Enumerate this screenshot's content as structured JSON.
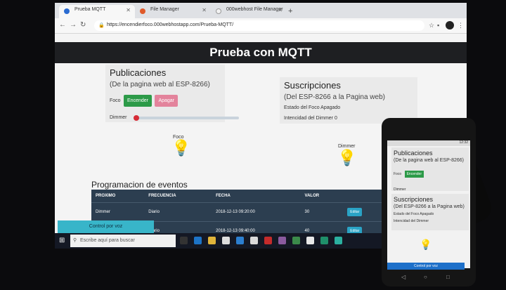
{
  "browser": {
    "tabs": [
      {
        "label": "Prueba MQTT"
      },
      {
        "label": "File Manager"
      },
      {
        "label": "000webhost File Manager"
      }
    ],
    "url": "https://encendierfoco.000webhostapp.com/Prueba-MQTT/"
  },
  "page": {
    "title": "Prueba con MQTT",
    "publicaciones": {
      "title": "Publicaciones",
      "subtitle": "(De la pagina web al ESP-8266)",
      "foco_label": "Foco",
      "on_label": "Encender",
      "off_label": "Apagar",
      "dimmer_label": "Dimmer"
    },
    "suscripciones": {
      "title": "Suscripciones",
      "subtitle": "(Del ESP-8266 a la Pagina web)",
      "estado_label": "Estado del Foco",
      "estado_value": "Apagado",
      "intensidad_label": "Intencidad del Dimmer",
      "intensidad_value": "0"
    },
    "foco_caption": "Foco",
    "dimmer_caption": "Dimmer",
    "schedule": {
      "title": "Programacion de eventos",
      "headers": [
        "PROXIMO",
        "FRECUENCIA",
        "FECHA",
        "VALOR"
      ],
      "rows": [
        {
          "proximo": "Dimmer",
          "frecuencia": "Diario",
          "fecha": "2018-12-13 09:20:00",
          "valor": "30",
          "action": "Editar"
        },
        {
          "proximo": "",
          "frecuencia": "Diario",
          "fecha": "2018-12-13 09:40:00",
          "valor": "40",
          "action": "Editar"
        }
      ]
    },
    "voice_button": "Control por voz"
  },
  "taskbar": {
    "search_placeholder": "Escribe aquí para buscar"
  },
  "phone": {
    "clock": "12:32",
    "publicaciones_title": "Publicaciones",
    "publicaciones_sub": "(De la pagina web al ESP-8266)",
    "foco_label": "Foco",
    "on_label": "Encender",
    "dimmer_label": "Dimmer",
    "suscripciones_title": "Suscripciones",
    "suscripciones_sub": "(Del ESP-8266 a la Pagina web)",
    "estado_label": "Estado del Foco",
    "estado_value": "Apagado",
    "intensidad_label": "Intencidad del Dimmer",
    "voice_button": "Control por voz"
  },
  "colors": {
    "navbar": "#1e1f22",
    "encender": "#2c9a48",
    "apagar": "#e3839c",
    "table": "#2c3e50",
    "voice": "#38b5c9"
  },
  "dimmer_level": 0
}
